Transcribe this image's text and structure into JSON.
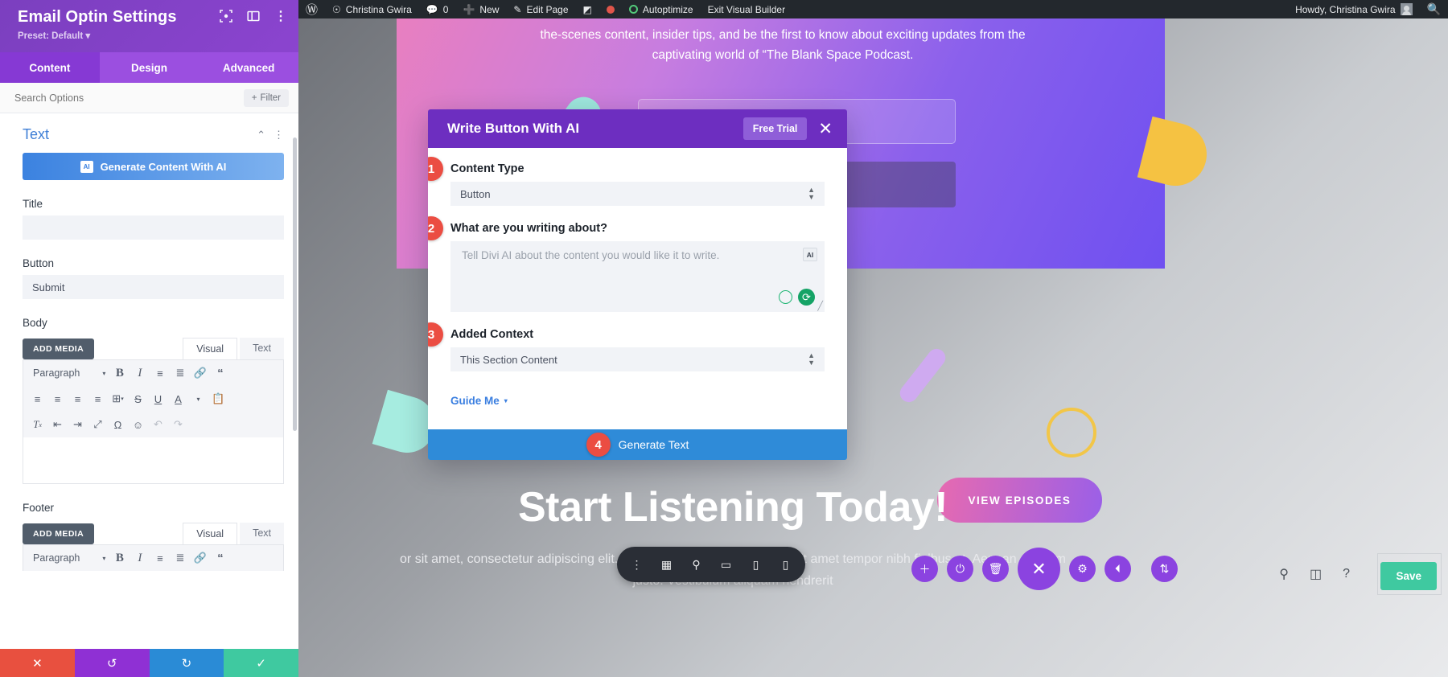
{
  "panel": {
    "title": "Email Optin Settings",
    "preset": "Preset: Default",
    "preset_caret": "▾",
    "tabs": [
      {
        "label": "Content",
        "active": true
      },
      {
        "label": "Design",
        "active": false
      },
      {
        "label": "Advanced",
        "active": false
      }
    ],
    "search_placeholder": "Search Options",
    "filter_label": "Filter",
    "filter_plus": "+",
    "section": {
      "title": "Text",
      "collapse_icon": "⌃",
      "more_icon": "⋮"
    },
    "ai_button": {
      "label": "Generate Content With AI",
      "chip": "AI"
    },
    "fields": [
      {
        "label": "Title",
        "value": ""
      },
      {
        "label": "Button",
        "value": "Submit"
      }
    ],
    "body_field": {
      "label": "Body",
      "add_media": "ADD MEDIA",
      "tabs": [
        {
          "label": "Visual",
          "active": true
        },
        {
          "label": "Text",
          "active": false
        }
      ],
      "paragraph_label": "Paragraph",
      "caret": "▾",
      "toolbar_row1": [
        "B",
        "I",
        "☰",
        "☲",
        "🔗",
        "❝"
      ],
      "toolbar_row2": [
        "≡",
        "≡",
        "≡",
        "≡",
        "⊞",
        "S",
        "U",
        "A",
        "▾",
        "📋"
      ],
      "toolbar_row3": [
        "Tx",
        "←≡",
        "≡→",
        "⤢",
        "Ω",
        "☺",
        "↶",
        "↷"
      ]
    },
    "footer_field": {
      "label": "Footer",
      "add_media": "ADD MEDIA",
      "tabs": [
        {
          "label": "Visual",
          "active": true
        },
        {
          "label": "Text",
          "active": false
        }
      ],
      "paragraph_label": "Paragraph"
    },
    "footer_actions": [
      {
        "name": "cancel",
        "icon": "✕",
        "color": "#e8503f"
      },
      {
        "name": "undo",
        "icon": "↺",
        "color": "#8f30d4"
      },
      {
        "name": "redo",
        "icon": "↻",
        "color": "#2a8bd6"
      },
      {
        "name": "save",
        "icon": "✓",
        "color": "#3fc9a0"
      }
    ]
  },
  "adminbar": {
    "wp_logo": "Ⓦ",
    "site_name": "Christina Gwira",
    "comments_count": "0",
    "new_label": "New",
    "edit_page_label": "Edit Page",
    "autoptimize_label": "Autoptimize",
    "exit_label": "Exit Visual Builder",
    "howdy": "Howdy, Christina Gwira"
  },
  "canvas": {
    "hero_paragraph": "the-scenes content, insider tips, and be the first to know about exciting updates from the captivating world of “The Blank Space Podcast.",
    "cta_pill": "VIEW EPISODES",
    "big_title": "Start Listening Today!",
    "body_copy": "or sit amet, consectetur adipiscing elit. Nam placerat risus tortor nibh sit amet tempor nibh finibus et. Aenean eu enim justo. Vestibulum aliquam hendrerit"
  },
  "modal": {
    "title": "Write Button With AI",
    "free_trial": "Free Trial",
    "close_icon": "✕",
    "steps": [
      {
        "num": "1",
        "label": "Content Type",
        "value": "Button"
      },
      {
        "num": "2",
        "label": "What are you writing about?",
        "placeholder": "Tell Divi AI about the content you would like it to write.",
        "ai_chip": "AI"
      },
      {
        "num": "3",
        "label": "Added Context",
        "value": "This Section Content"
      }
    ],
    "guide_me": "Guide Me",
    "guide_caret": "▾",
    "generate": {
      "num": "4",
      "label": "Generate Text"
    }
  },
  "builder": {
    "bar_icons": [
      "⋮",
      "▦",
      "⚲",
      "▭",
      "▯",
      "▯"
    ],
    "fabs": [
      {
        "name": "add",
        "icon": "＋",
        "kind": "purple"
      },
      {
        "name": "power",
        "icon": "⏻",
        "kind": "purple"
      },
      {
        "name": "trash",
        "icon": "🗑",
        "kind": "purple"
      },
      {
        "name": "close",
        "icon": "✕",
        "kind": "big"
      },
      {
        "name": "settings",
        "icon": "⚙",
        "kind": "purple"
      },
      {
        "name": "history",
        "icon": "◴",
        "kind": "purple"
      },
      {
        "name": "sort",
        "icon": "⇅",
        "kind": "purple"
      }
    ],
    "right_tools": [
      "⚲",
      "≣",
      "?"
    ],
    "save_label": "Save"
  },
  "colors": {
    "panel_purple": "#7b3fbf",
    "tab_purple": "#9b4fe0",
    "modal_purple": "#6d2ec0",
    "accent_red": "#eb4d42",
    "accent_blue": "#2f8bd8",
    "ai_blue": "#3b82e0",
    "save_green": "#3fc9a0"
  }
}
